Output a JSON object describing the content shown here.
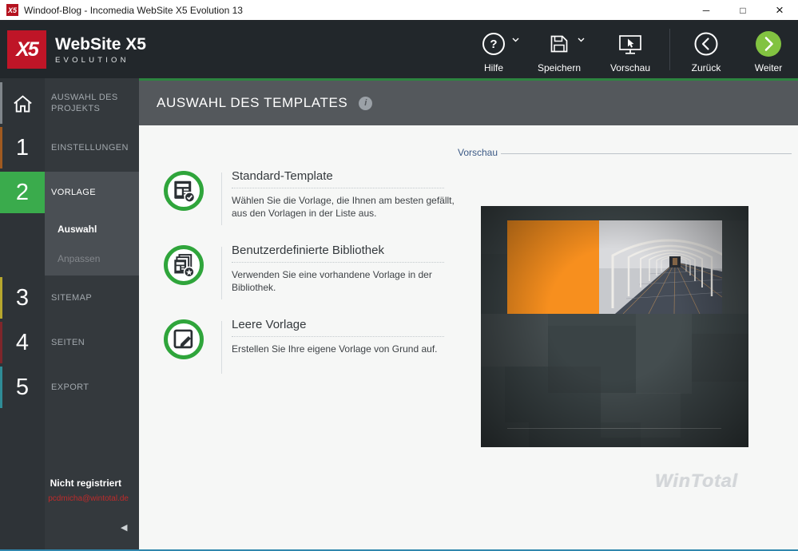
{
  "window": {
    "title": "Windoof-Blog - Incomedia WebSite X5 Evolution 13",
    "controls": {
      "minimize": "─",
      "maximize": "□",
      "close": "×"
    }
  },
  "branding": {
    "logo_glyph": "X5",
    "logo_title": "WebSite X5",
    "logo_subtitle": "EVOLUTION"
  },
  "toolbar": {
    "buttons": [
      {
        "label": "Hilfe",
        "icon": "help-icon",
        "has_dropdown": true
      },
      {
        "label": "Speichern",
        "icon": "save-icon",
        "has_dropdown": true
      },
      {
        "label": "Vorschau",
        "icon": "preview-icon",
        "has_dropdown": false
      },
      {
        "label": "Zurück",
        "icon": "back-icon",
        "has_dropdown": false
      },
      {
        "label": "Weiter",
        "icon": "next-icon",
        "has_dropdown": false
      }
    ]
  },
  "sidebar": {
    "steps": [
      {
        "number": "",
        "label": "AUSWAHL DES PROJEKTS",
        "icon": "home-icon",
        "stripe_color": "#80868b",
        "active": false
      },
      {
        "number": "1",
        "label": "EINSTELLUNGEN",
        "stripe_color": "#a05a20",
        "active": false
      },
      {
        "number": "2",
        "label": "VORLAGE",
        "stripe_color": "#3aab4c",
        "active": true
      },
      {
        "number": "3",
        "label": "SITEMAP",
        "stripe_color": "#b7a72e",
        "active": false
      },
      {
        "number": "4",
        "label": "SEITEN",
        "stripe_color": "#7e262b",
        "active": false
      },
      {
        "number": "5",
        "label": "EXPORT",
        "stripe_color": "#2f8c96",
        "active": false
      }
    ],
    "subitems": [
      {
        "label": "Auswahl",
        "active": true
      },
      {
        "label": "Anpassen",
        "active": false
      }
    ],
    "registration": {
      "status": "Nicht registriert",
      "email": "pcdmicha@wintotal.de"
    },
    "collapse_icon": "◀"
  },
  "content": {
    "header": {
      "title": "AUSWAHL DES TEMPLATES",
      "info_glyph": "i"
    },
    "options": [
      {
        "title": "Standard-Template",
        "description": "Wählen Sie die Vorlage, die Ihnen am besten gefällt, aus den Vorlagen in der Liste aus.",
        "icon": "standard-template-icon"
      },
      {
        "title": "Benutzerdefinierte Bibliothek",
        "description": "Verwenden Sie eine vorhandene Vorlage in der Bibliothek.",
        "icon": "custom-library-icon"
      },
      {
        "title": "Leere Vorlage",
        "description": "Erstellen Sie Ihre eigene Vorlage von Grund auf.",
        "icon": "empty-template-icon"
      }
    ],
    "preview": {
      "label": "Vorschau"
    },
    "watermark": "WinTotal"
  },
  "colors": {
    "accent_green": "#82c341",
    "step_active_green": "#3aab4c",
    "icon_ring_green": "#2fa53b",
    "template_orange": "#f78f1e",
    "header_bar": "#54585c",
    "toolbar_bg": "#22272b",
    "sidebar_bg": "#2e3337",
    "window_border": "#3087ad",
    "email_red": "#bf2b2b"
  }
}
